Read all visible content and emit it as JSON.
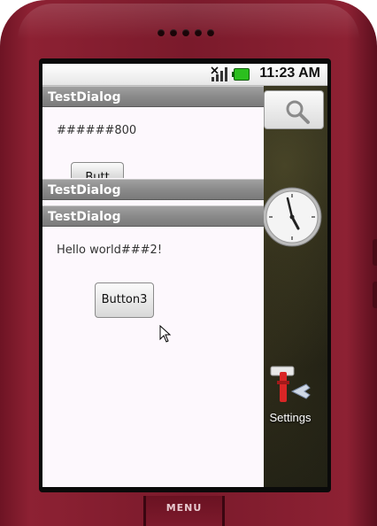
{
  "statusbar": {
    "time": "11:23 AM",
    "signal_icon": "signal-off-icon",
    "battery_icon": "battery-icon"
  },
  "home": {
    "search_icon": "search-icon",
    "clock_icon": "analog-clock-icon",
    "settings_label": "Settings"
  },
  "dialogs": {
    "dialog1": {
      "title": "TestDialog",
      "text": "######800",
      "button_label": "Butt"
    },
    "dialog2": {
      "title": "TestDialog"
    },
    "dialog3": {
      "title": "TestDialog",
      "text": "Hello world###2!",
      "button_label": "Button3"
    }
  },
  "device": {
    "menu_label": "MENU",
    "body_color": "#8d2133"
  }
}
